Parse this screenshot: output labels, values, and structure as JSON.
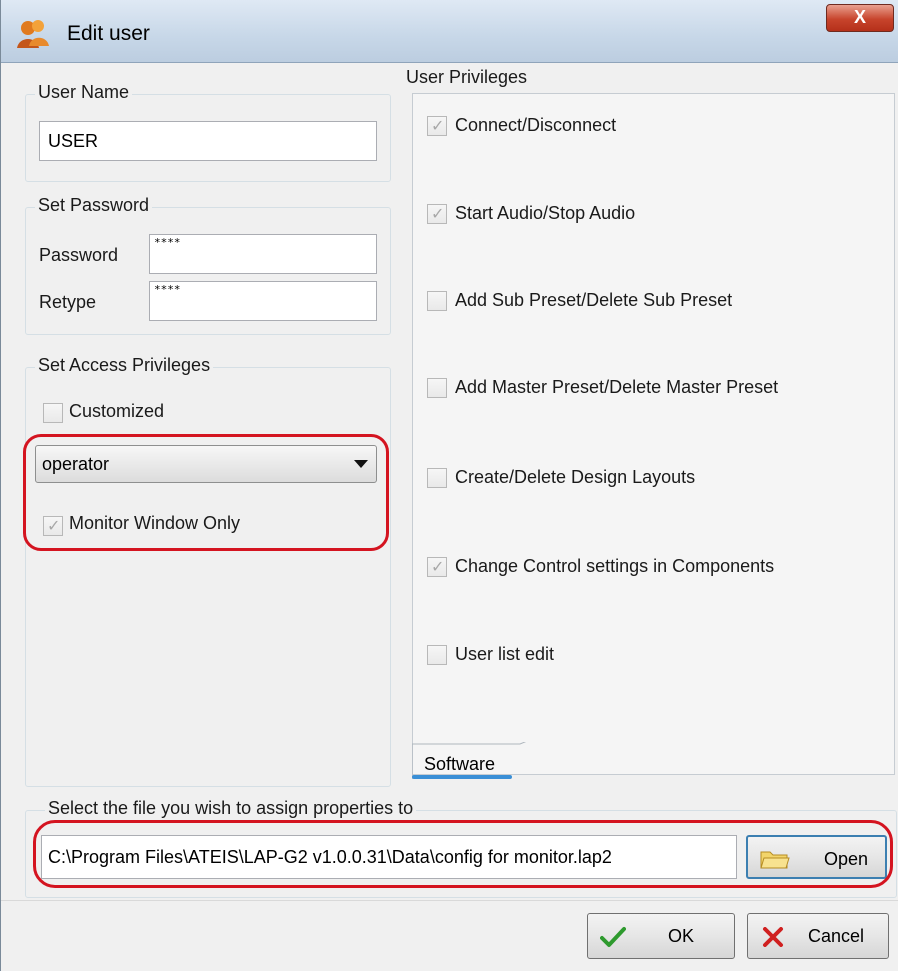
{
  "window": {
    "title": "Edit user",
    "close_label": "X"
  },
  "user_name": {
    "group_label": "User Name",
    "value": "USER"
  },
  "set_password": {
    "group_label": "Set Password",
    "password_label": "Password",
    "password_value": "****",
    "retype_label": "Retype",
    "retype_value": "****"
  },
  "access": {
    "group_label": "Set Access Privileges",
    "customized_label": "Customized",
    "customized_checked": false,
    "role_selected": "operator",
    "monitor_only_label": "Monitor Window Only",
    "monitor_only_checked": true
  },
  "privileges": {
    "group_label": "User Privileges",
    "items": [
      {
        "label": "Connect/Disconnect",
        "checked": true
      },
      {
        "label": "Start Audio/Stop Audio",
        "checked": true
      },
      {
        "label": "Add Sub Preset/Delete Sub Preset",
        "checked": false
      },
      {
        "label": "Add Master Preset/Delete Master Preset",
        "checked": false
      },
      {
        "label": "Create/Delete Design Layouts",
        "checked": false
      },
      {
        "label": "Change Control settings in Components",
        "checked": true
      },
      {
        "label": "User list edit",
        "checked": false
      }
    ],
    "tab_label": "Software"
  },
  "file": {
    "group_label": "Select the file you wish to assign properties to",
    "path": "C:\\Program Files\\ATEIS\\LAP-G2 v1.0.0.31\\Data\\config for monitor.lap2",
    "open_label": "Open"
  },
  "buttons": {
    "ok_label": "OK",
    "cancel_label": "Cancel"
  },
  "colors": {
    "highlight": "#d41420",
    "titlebar": "#c7d7e8",
    "tab_accent": "#3a8fd6"
  }
}
